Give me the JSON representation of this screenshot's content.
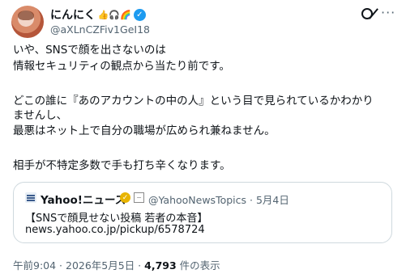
{
  "author": {
    "display_name": "にんにく",
    "emojis": "👍🎧🌈",
    "handle": "@aXLnCZFiv1GeI18",
    "verified_mark": "✓"
  },
  "post": {
    "lines": [
      "いや、SNSで顔を出さないのは",
      "情報セキュリティの観点から当たり前です。",
      "どこの誰に『あのアカウントの中の人』という目で見られているかわかり",
      "ませんし、",
      "最悪はネット上で自分の職場が広められ兼ねません。",
      "相手が不特定多数で手も打ち辛くなります。"
    ]
  },
  "quote": {
    "source_name": "Yahoo!ニュース",
    "verified_mark": "✓",
    "badge": "−",
    "handle_date": "@YahooNewsTopics · 5月4日",
    "headline": "【SNSで顔見せない投稿 若者の本音】",
    "link": "news.yahoo.co.jp/pickup/6578724"
  },
  "meta": {
    "time_date": "午前9:04 · 2026年5月5日 · ",
    "views": "4,793",
    "views_label": " 件の表示"
  },
  "icons": {
    "grok": "grok-icon",
    "more": "more-options-icon"
  },
  "colors": {
    "text": "#0f1419",
    "secondary": "#536471",
    "verified_blue": "#1d9bf0",
    "verified_gold": "#e8b400",
    "border": "#cfd9de"
  }
}
